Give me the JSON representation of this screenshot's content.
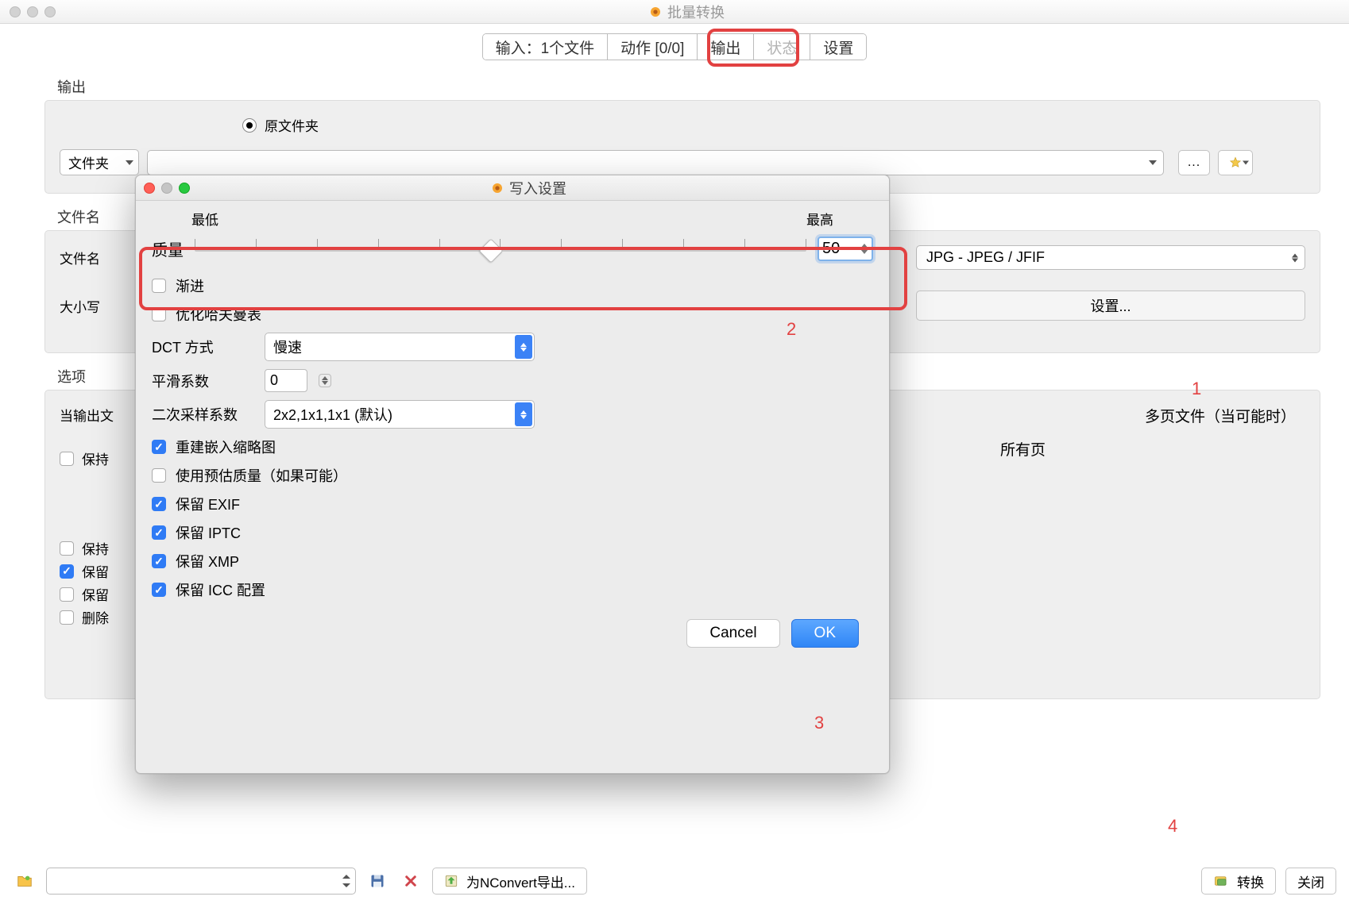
{
  "window": {
    "title": "批量转换"
  },
  "tabs": {
    "input": "输入：1个文件",
    "actions": "动作 [0/0]",
    "output": "输出",
    "status": "状态",
    "settings": "设置"
  },
  "output_section": {
    "label": "输出",
    "original_folder_radio": "原文件夹",
    "folder_select_prefix": "文件夹"
  },
  "filename_section": {
    "label": "文件名",
    "filename_label": "文件名",
    "case_label": "大小写",
    "format_value": "JPG - JPEG / JFIF",
    "settings_button": "设置..."
  },
  "options_section": {
    "label": "选项",
    "when_output_exists": "当输出文",
    "preserve1": "保持",
    "preserve2": "保持",
    "preserve3": "保留",
    "preserve4": "保留",
    "delete": "删除",
    "multipage": "多页文件（当可能时）",
    "allpages": "所有页"
  },
  "footer": {
    "export_btn": "为NConvert导出...",
    "convert_btn": "转换",
    "close_btn": "关闭"
  },
  "modal": {
    "title": "写入设置",
    "lowest": "最低",
    "highest": "最高",
    "quality_label": "质量",
    "quality_value": "50",
    "progressive": "渐进",
    "optimize_huffman": "优化哈夫曼表",
    "dct_label": "DCT 方式",
    "dct_value": "慢速",
    "smoothing_label": "平滑系数",
    "smoothing_value": "0",
    "subsampling_label": "二次采样系数",
    "subsampling_value": "2x2,1x1,1x1 (默认)",
    "rebuild_thumbnail": "重建嵌入缩略图",
    "use_estimated_quality": "使用预估质量（如果可能）",
    "keep_exif": "保留 EXIF",
    "keep_iptc": "保留 IPTC",
    "keep_xmp": "保留 XMP",
    "keep_icc": "保留 ICC 配置",
    "cancel": "Cancel",
    "ok": "OK"
  },
  "annotations": {
    "n1": "1",
    "n2": "2",
    "n3": "3",
    "n4": "4"
  }
}
